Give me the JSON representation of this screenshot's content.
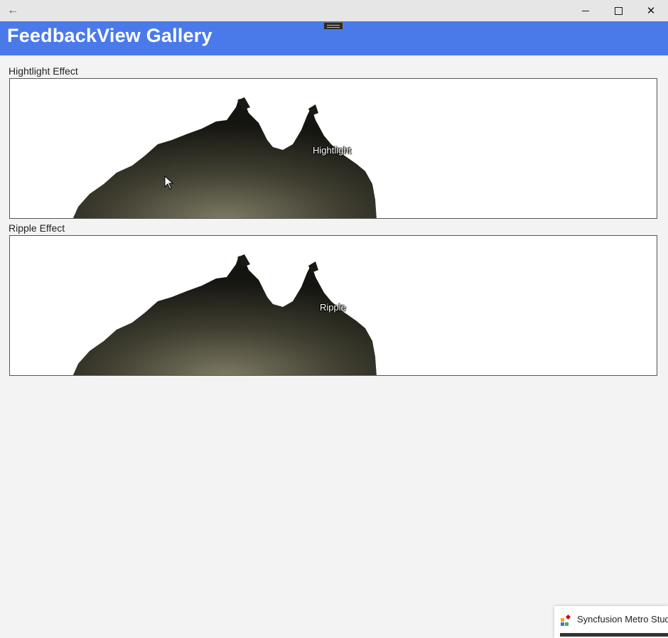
{
  "window": {
    "back_glyph": "←",
    "close_glyph": "✕",
    "icons": [
      "back-arrow-icon",
      "minimize-icon",
      "maximize-icon",
      "close-icon"
    ]
  },
  "header": {
    "title": "FeedbackView Gallery",
    "background": "#4a7aea"
  },
  "sections": [
    {
      "label": "Hightlight Effect",
      "overlay_text": "Hightlight"
    },
    {
      "label": "Ripple Effect",
      "overlay_text": "Ripple"
    }
  ],
  "toast": {
    "app_name": "Syncfusion Metro Studio",
    "icon": "syncfusion-app-icon"
  }
}
